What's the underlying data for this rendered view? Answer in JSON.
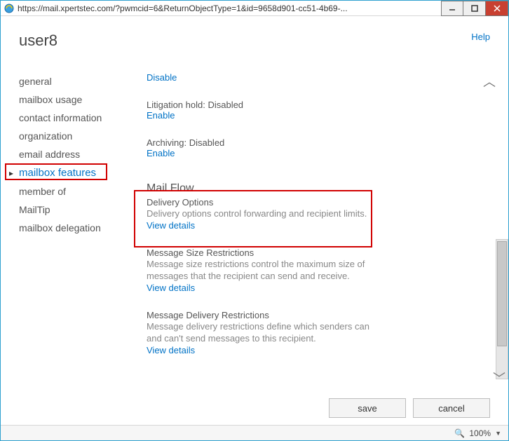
{
  "titlebar": {
    "url": "https://mail.xpertstec.com/?pwmcid=6&ReturnObjectType=1&id=9658d901-cc51-4b69-..."
  },
  "header": {
    "title": "user8",
    "help": "Help"
  },
  "sidebar": {
    "items": [
      {
        "label": "general"
      },
      {
        "label": "mailbox usage"
      },
      {
        "label": "contact information"
      },
      {
        "label": "organization"
      },
      {
        "label": "email address"
      },
      {
        "label": "mailbox features"
      },
      {
        "label": "member of"
      },
      {
        "label": "MailTip"
      },
      {
        "label": "mailbox delegation"
      }
    ]
  },
  "main": {
    "disable_link": "Disable",
    "litigation": {
      "label": "Litigation hold: Disabled",
      "action": "Enable"
    },
    "archiving": {
      "label": "Archiving: Disabled",
      "action": "Enable"
    },
    "mailflow": {
      "heading": "Mail Flow",
      "subheading": "Delivery Options",
      "desc": "Delivery options control forwarding and recipient limits.",
      "action": "View details"
    },
    "msgsize": {
      "heading": "Message Size Restrictions",
      "desc": "Message size restrictions control the maximum size of messages that the recipient can send and receive.",
      "action": "View details"
    },
    "msgdelivery": {
      "heading": "Message Delivery Restrictions",
      "desc": "Message delivery restrictions define which senders can and can't send messages to this recipient.",
      "action": "View details"
    }
  },
  "buttons": {
    "save": "save",
    "cancel": "cancel"
  },
  "statusbar": {
    "zoom": "100%"
  }
}
